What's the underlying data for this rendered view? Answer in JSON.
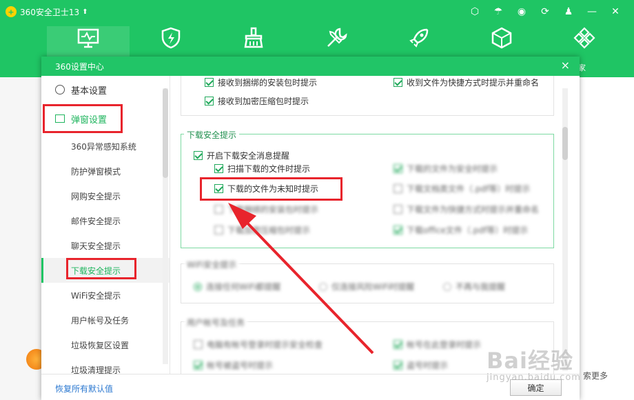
{
  "app": {
    "title": "360安全卫士13",
    "background_right_text": "索更多",
    "background_tail_char": "家"
  },
  "dialog": {
    "title": "360设置中心",
    "close_glyph": "×"
  },
  "sidebar": {
    "top_item": "基本设置",
    "section": "弹窗设置",
    "items": [
      {
        "label": "360异常感知系统"
      },
      {
        "label": "防护弹窗模式"
      },
      {
        "label": "网购安全提示"
      },
      {
        "label": "邮件安全提示"
      },
      {
        "label": "聊天安全提示"
      },
      {
        "label": "下载安全提示"
      },
      {
        "label": "WiFi安全提示"
      },
      {
        "label": "用户帐号及任务"
      },
      {
        "label": "垃圾恢复区设置"
      },
      {
        "label": "垃圾清理提示"
      }
    ]
  },
  "content": {
    "prev_group": {
      "row1_left": "接收到捆绑的安装包时提示",
      "row1_right": "收到文件为快捷方式时提示并重命名",
      "row2_left": "接收到加密压缩包时提示"
    },
    "download_group": {
      "legend": "下载安全提示",
      "master": "开启下载安全消息提醒",
      "left": [
        {
          "label": "扫描下载的文件时提示",
          "checked": true
        },
        {
          "label": "下载的文件为未知时提示",
          "checked": true
        },
        {
          "label": "下载捆绑的安装包时提示",
          "checked": false
        },
        {
          "label": "下载加密压缩包时提示",
          "checked": false
        }
      ],
      "right": [
        {
          "label": "下载的文件为安全时提示",
          "checked": true
        },
        {
          "label": "下载文档类文件（.pdf等）时提示",
          "checked": false
        },
        {
          "label": "下载文件为快捷方式时提示并重命名",
          "checked": false
        },
        {
          "label": "下载office文件（.pdf等）时提示",
          "checked": true
        }
      ]
    },
    "wifi_group": {
      "legend": "WiFi安全提示",
      "options": [
        "连接任何WiFi都提醒",
        "仅连接风险WiFi时提醒",
        "不再与我提醒"
      ]
    },
    "account_group": {
      "legend": "用户帐号及任务",
      "left": [
        {
          "label": "电脑有帐号登录时提示安全检查",
          "checked": false
        },
        {
          "label": "帐号被盗号时提示",
          "checked": true
        }
      ],
      "right": [
        {
          "label": "帐号在此登录时提示",
          "checked": true
        },
        {
          "label": "盗号时提示",
          "checked": true
        }
      ]
    }
  },
  "footer": {
    "restore": "恢复所有默认值",
    "ok": "确定"
  },
  "watermark": {
    "main": "Bai经验",
    "sub": "jingyan.baidu.com"
  },
  "colors": {
    "brand_green": "#1fc564",
    "annotation_red": "#e8242c",
    "link_blue": "#2b78d0"
  }
}
